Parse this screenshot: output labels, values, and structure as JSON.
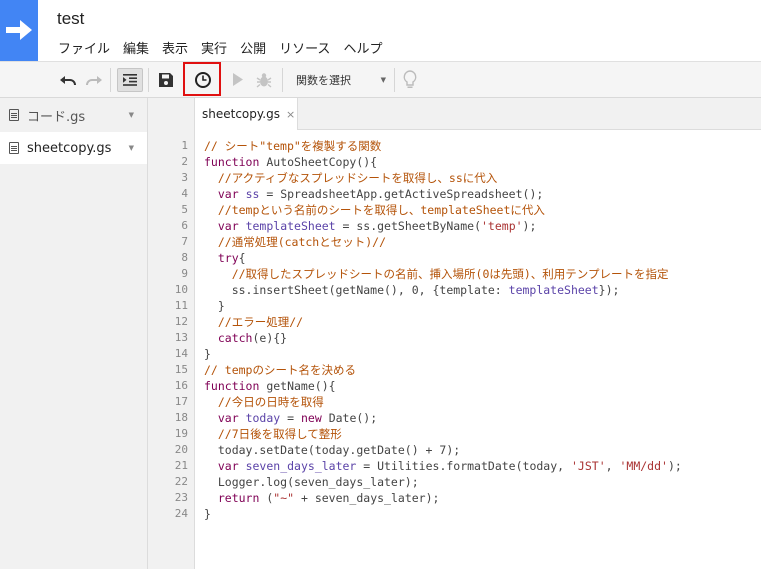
{
  "app": {
    "title": "test",
    "brand_color": "#4285f4"
  },
  "menu": [
    "ファイル",
    "編集",
    "表示",
    "実行",
    "公開",
    "リソース",
    "ヘルプ"
  ],
  "toolbar": {
    "function_select": "関数を選択",
    "highlight_color": "#e01010"
  },
  "files": [
    {
      "name": "コード.gs",
      "active": false
    },
    {
      "name": "sheetcopy.gs",
      "active": true
    }
  ],
  "tabs": [
    {
      "label": "sheetcopy.gs",
      "close": "×"
    }
  ],
  "code": {
    "line_numbers": [
      "1",
      "2",
      "3",
      "4",
      "5",
      "6",
      "7",
      "8",
      "9",
      "10",
      "11",
      "12",
      "13",
      "14",
      "15",
      "16",
      "17",
      "18",
      "19",
      "20",
      "21",
      "22",
      "23",
      "24"
    ],
    "lines": [
      [
        [
          "// シート\"temp\"を複製する関数",
          "c"
        ]
      ],
      [
        [
          "function",
          "k"
        ],
        [
          " AutoSheetCopy(){",
          "p"
        ]
      ],
      [
        [
          "  //アクティブなスプレッドシートを取得し、ssに代入",
          "c"
        ]
      ],
      [
        [
          "  ",
          "p"
        ],
        [
          "var",
          "k"
        ],
        [
          " ",
          "p"
        ],
        [
          "ss",
          "v"
        ],
        [
          " = SpreadsheetApp.getActiveSpreadsheet();",
          "p"
        ]
      ],
      [
        [
          "  //tempという名前のシートを取得し、templateSheetに代入",
          "c"
        ]
      ],
      [
        [
          "  ",
          "p"
        ],
        [
          "var",
          "k"
        ],
        [
          " ",
          "p"
        ],
        [
          "templateSheet",
          "v"
        ],
        [
          " = ss.getSheetByName(",
          "p"
        ],
        [
          "'temp'",
          "s"
        ],
        [
          ");",
          "p"
        ]
      ],
      [
        [
          "  //通常処理(catchとセット)//",
          "c"
        ]
      ],
      [
        [
          "  ",
          "p"
        ],
        [
          "try",
          "k"
        ],
        [
          "{",
          "p"
        ]
      ],
      [
        [
          "    //取得したスプレッドシートの名前、挿入場所(0は先頭)、利用テンプレートを指定",
          "c"
        ]
      ],
      [
        [
          "    ss.insertSheet(getName(), 0, {template: ",
          "p"
        ],
        [
          "templateSheet",
          "v"
        ],
        [
          "});",
          "p"
        ]
      ],
      [
        [
          "  }",
          "p"
        ]
      ],
      [
        [
          "  //エラー処理//",
          "c"
        ]
      ],
      [
        [
          "  ",
          "p"
        ],
        [
          "catch",
          "k"
        ],
        [
          "(e){}",
          "p"
        ]
      ],
      [
        [
          "}",
          "p"
        ]
      ],
      [
        [
          "// tempのシート名を決める",
          "c"
        ]
      ],
      [
        [
          "function",
          "k"
        ],
        [
          " getName(){",
          "p"
        ]
      ],
      [
        [
          "  //今日の日時を取得",
          "c"
        ]
      ],
      [
        [
          "  ",
          "p"
        ],
        [
          "var",
          "k"
        ],
        [
          " ",
          "p"
        ],
        [
          "today",
          "v"
        ],
        [
          " = ",
          "p"
        ],
        [
          "new",
          "k"
        ],
        [
          " Date();",
          "p"
        ]
      ],
      [
        [
          "  //7日後を取得して整形",
          "c"
        ]
      ],
      [
        [
          "  today.setDate(today.getDate() + 7);",
          "p"
        ]
      ],
      [
        [
          "  ",
          "p"
        ],
        [
          "var",
          "k"
        ],
        [
          " ",
          "p"
        ],
        [
          "seven_days_later",
          "v"
        ],
        [
          " = Utilities.formatDate(today, ",
          "p"
        ],
        [
          "'JST'",
          "s"
        ],
        [
          ", ",
          "p"
        ],
        [
          "'MM/dd'",
          "s"
        ],
        [
          ");",
          "p"
        ]
      ],
      [
        [
          "  Logger.log(seven_days_later);",
          "p"
        ]
      ],
      [
        [
          "  ",
          "p"
        ],
        [
          "return",
          "k"
        ],
        [
          " (",
          "p"
        ],
        [
          "\"~\"",
          "s"
        ],
        [
          " + seven_days_later);",
          "p"
        ]
      ],
      [
        [
          "}",
          "p"
        ]
      ]
    ]
  },
  "icons": {
    "undo": "undo-icon",
    "redo": "redo-icon",
    "indent": "indent-icon",
    "save": "save-icon",
    "trigger": "clock-icon",
    "run": "play-icon",
    "debug": "bug-icon",
    "hint": "lightbulb-icon"
  }
}
